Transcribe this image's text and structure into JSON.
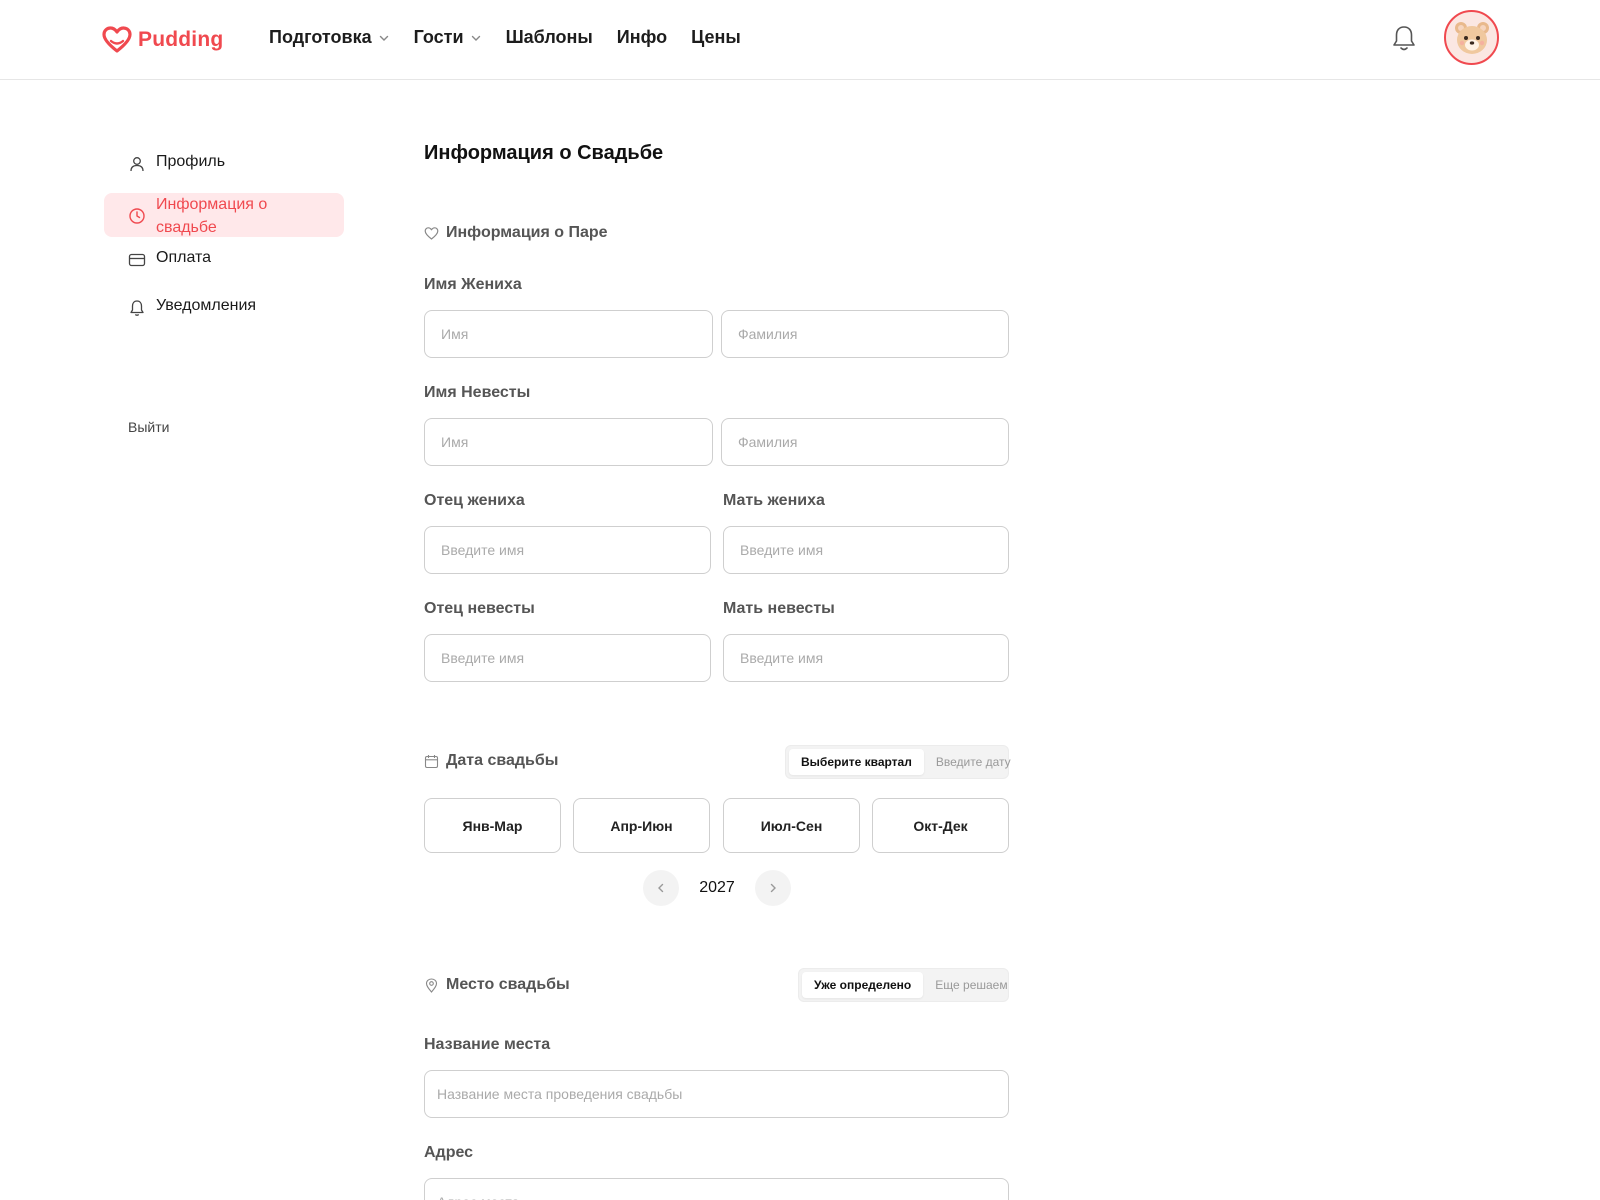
{
  "brand": {
    "name": "Pudding",
    "accent_color": "#f0494f"
  },
  "nav": {
    "items": [
      {
        "label": "Подготовка",
        "has_dropdown": true
      },
      {
        "label": "Гости",
        "has_dropdown": true
      },
      {
        "label": "Шаблоны",
        "has_dropdown": false
      },
      {
        "label": "Инфо",
        "has_dropdown": false
      },
      {
        "label": "Цены",
        "has_dropdown": false
      }
    ],
    "notification_icon": "bell-icon",
    "avatar_icon": "bear-avatar"
  },
  "sidebar": {
    "items": [
      {
        "label": "Профиль",
        "icon": "user-icon",
        "active": false
      },
      {
        "label": "Информация о свадьбе",
        "icon": "clock-icon",
        "active": true
      },
      {
        "label": "Оплата",
        "icon": "card-icon",
        "active": false
      },
      {
        "label": "Уведомления",
        "icon": "bell-icon",
        "active": false
      }
    ],
    "logout_label": "Выйти"
  },
  "page": {
    "title": "Информация о Свадьбе"
  },
  "couple": {
    "section_title": "Информация о Паре",
    "groom_label": "Имя Жениха",
    "bride_label": "Имя Невесты",
    "first_name_placeholder": "Имя",
    "last_name_placeholder": "Фамилия",
    "groom_father_label": "Отец жениха",
    "groom_mother_label": "Мать жениха",
    "bride_father_label": "Отец невесты",
    "bride_mother_label": "Мать невесты",
    "name_placeholder": "Введите имя"
  },
  "date": {
    "section_title": "Дата свадьбы",
    "toggle": [
      "Выберите квартал",
      "Введите дату"
    ],
    "toggle_selected": 0,
    "quarters": [
      "Янв-Мар",
      "Апр-Июн",
      "Июл-Сен",
      "Окт-Дек"
    ],
    "year": "2027"
  },
  "venue": {
    "section_title": "Место свадьбы",
    "toggle": [
      "Уже определено",
      "Еще решаем"
    ],
    "toggle_selected": 0,
    "name_label": "Название места",
    "name_placeholder": "Название места проведения свадьбы",
    "address_label": "Адрес",
    "address_placeholder": "Адрес места"
  }
}
